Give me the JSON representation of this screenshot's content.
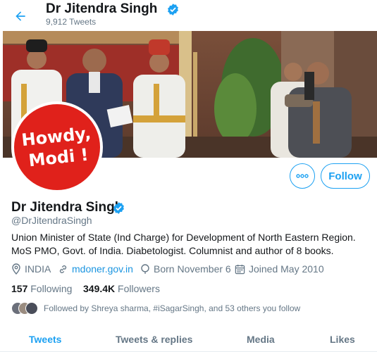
{
  "header": {
    "name": "Dr Jitendra Singh",
    "tweet_count": "9,912 Tweets"
  },
  "avatar": {
    "line1": "Howdy,",
    "line2": "Modi !"
  },
  "actions": {
    "follow_label": "Follow"
  },
  "profile": {
    "name": "Dr Jitendra Singh",
    "handle": "@DrJitendraSingh",
    "bio": "Union Minister of State (Ind Charge) for Development of North Eastern Region. MoS PMO, Govt. of India. Diabetologist. Columnist and author of 8 books.",
    "location": "INDIA",
    "website": "mdoner.gov.in",
    "birthday": "Born November 6",
    "joined": "Joined May 2010"
  },
  "stats": {
    "following_count": "157",
    "following_label": "Following",
    "followers_count": "349.4K",
    "followers_label": "Followers"
  },
  "followed_by": "Followed by Shreya sharma, #iSagarSingh, and 53 others you follow",
  "tabs": [
    "Tweets",
    "Tweets & replies",
    "Media",
    "Likes"
  ],
  "colors": {
    "accent": "#1da1f2",
    "avatar_bg": "#e0211b",
    "secondary_text": "#657786"
  },
  "icons": [
    "back-arrow-icon",
    "verified-badge-icon",
    "more-dots-icon",
    "location-icon",
    "link-icon",
    "birthday-icon",
    "calendar-icon"
  ]
}
